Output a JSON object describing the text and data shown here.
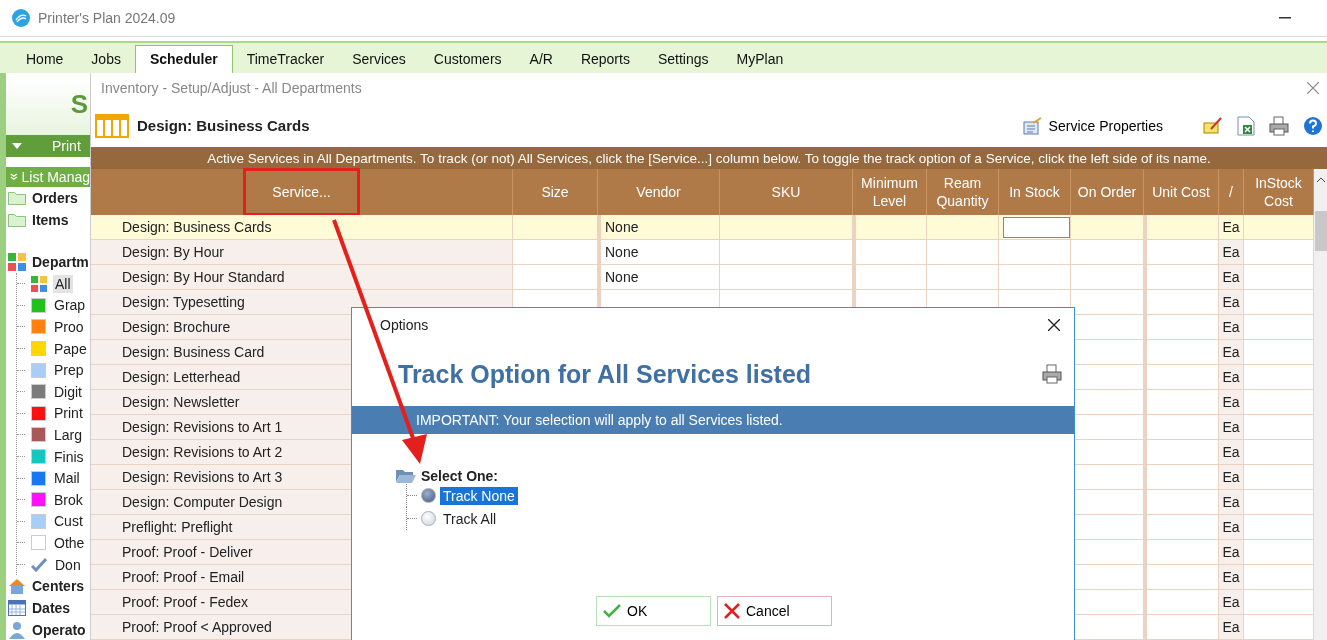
{
  "window": {
    "title": "Printer's Plan 2024.09"
  },
  "tabs": [
    {
      "label": "Home",
      "selected": false
    },
    {
      "label": "Jobs",
      "selected": false
    },
    {
      "label": "Scheduler",
      "selected": true
    },
    {
      "label": "TimeTracker",
      "selected": false
    },
    {
      "label": "Services",
      "selected": false
    },
    {
      "label": "Customers",
      "selected": false
    },
    {
      "label": "A/R",
      "selected": false
    },
    {
      "label": "Reports",
      "selected": false
    },
    {
      "label": "Settings",
      "selected": false
    },
    {
      "label": "MyPlan",
      "selected": false
    }
  ],
  "sidebar": {
    "banner_letter": "S",
    "print_button": "Print",
    "list_header": "List Manag",
    "folders": [
      {
        "label": "Orders"
      },
      {
        "label": "Items"
      }
    ],
    "departments": {
      "label": "Departm",
      "children": [
        {
          "label": "All",
          "kind": "all",
          "selected": true
        },
        {
          "label": "Grap",
          "kind": "color",
          "color": "#22c21c",
          "selected": false
        },
        {
          "label": "Proo",
          "kind": "color",
          "color": "#ff7f0f",
          "selected": false
        },
        {
          "label": "Pape",
          "kind": "color",
          "color": "#ffd700",
          "selected": false
        },
        {
          "label": "Prep",
          "kind": "color",
          "color": "#a8cdf7",
          "selected": false
        },
        {
          "label": "Digit",
          "kind": "color",
          "color": "#7b7b7b",
          "selected": false
        },
        {
          "label": "Print",
          "kind": "color",
          "color": "#ff1010",
          "selected": false
        },
        {
          "label": "Larg",
          "kind": "color",
          "color": "#a85858",
          "selected": false
        },
        {
          "label": "Finis",
          "kind": "color",
          "color": "#15c7c0",
          "selected": false
        },
        {
          "label": "Mail",
          "kind": "color",
          "color": "#1877f2",
          "selected": false
        },
        {
          "label": "Brok",
          "kind": "color",
          "color": "#ff10ff",
          "selected": false
        },
        {
          "label": "Cust",
          "kind": "color",
          "color": "#a8cdf7",
          "selected": false
        },
        {
          "label": "Othe",
          "kind": "color",
          "color": "#ffffff",
          "selected": false
        },
        {
          "label": "Don",
          "kind": "done",
          "selected": false
        }
      ]
    },
    "more": [
      {
        "label": "Centers",
        "kind": "house"
      },
      {
        "label": "Dates",
        "kind": "calendar"
      },
      {
        "label": "Operato",
        "kind": "person"
      }
    ]
  },
  "inventory": {
    "breadcrumb": "Inventory - Setup/Adjust - All Departments",
    "title": "Design: Business Cards",
    "service_properties": "Service Properties",
    "banner": "Active Services in All Departments. To track (or not) All Services, click the [Service...] column below. To toggle the track option of a Service, click the left side of its name.",
    "columns": [
      {
        "label": "Service...",
        "circled": true
      },
      {
        "label": "Size",
        "circled": false
      },
      {
        "label": "Vendor",
        "circled": false
      },
      {
        "label": "SKU",
        "circled": false
      },
      {
        "label": "Minimum Level",
        "circled": false
      },
      {
        "label": "Ream Quantity",
        "circled": false
      },
      {
        "label": "In Stock",
        "circled": false
      },
      {
        "label": "On Order",
        "circled": false
      },
      {
        "label": "Unit Cost",
        "circled": false
      },
      {
        "label": "/",
        "circled": false
      },
      {
        "label": "InStock Cost",
        "circled": false
      }
    ],
    "rows": [
      {
        "service": "Design: Business Cards",
        "vendor": "None",
        "unit": "Ea",
        "selected": true
      },
      {
        "service": "Design: By Hour",
        "vendor": "None",
        "unit": "Ea",
        "selected": false
      },
      {
        "service": "Design: By Hour Standard",
        "vendor": "None",
        "unit": "Ea",
        "selected": false
      },
      {
        "service": "Design: Typesetting",
        "unit": "Ea",
        "selected": false
      },
      {
        "service": "Design: Brochure",
        "unit": "Ea",
        "selected": false
      },
      {
        "service": "Design: Business Card",
        "unit": "Ea",
        "selected": false
      },
      {
        "service": "Design: Letterhead",
        "unit": "Ea",
        "selected": false
      },
      {
        "service": "Design: Newsletter",
        "unit": "Ea",
        "selected": false
      },
      {
        "service": "Design: Revisions to Art 1",
        "unit": "Ea",
        "selected": false
      },
      {
        "service": "Design: Revisions to Art 2",
        "unit": "Ea",
        "selected": false
      },
      {
        "service": "Design: Revisions to Art 3",
        "unit": "Ea",
        "selected": false
      },
      {
        "service": "Design: Computer Design",
        "unit": "Ea",
        "selected": false
      },
      {
        "service": "Preflight: Preflight",
        "unit": "Ea",
        "selected": false
      },
      {
        "service": "Proof: Proof - Deliver",
        "unit": "Ea",
        "selected": false
      },
      {
        "service": "Proof: Proof - Email",
        "unit": "Ea",
        "selected": false
      },
      {
        "service": "Proof: Proof - Fedex",
        "unit": "Ea",
        "selected": false
      },
      {
        "service": "Proof: Proof <  Approved",
        "unit": "Ea",
        "selected": false
      }
    ]
  },
  "dialog": {
    "title": "Options",
    "heading": "Track Option for All Services listed",
    "notice": "IMPORTANT: Your selection will apply to all Services listed.",
    "group": "Select One:",
    "options": [
      {
        "label": "Track None",
        "selected": true
      },
      {
        "label": "Track All",
        "selected": false
      }
    ],
    "buttons": [
      {
        "label": "OK",
        "kind": "ok"
      },
      {
        "label": "Cancel",
        "kind": "cancel"
      }
    ]
  }
}
